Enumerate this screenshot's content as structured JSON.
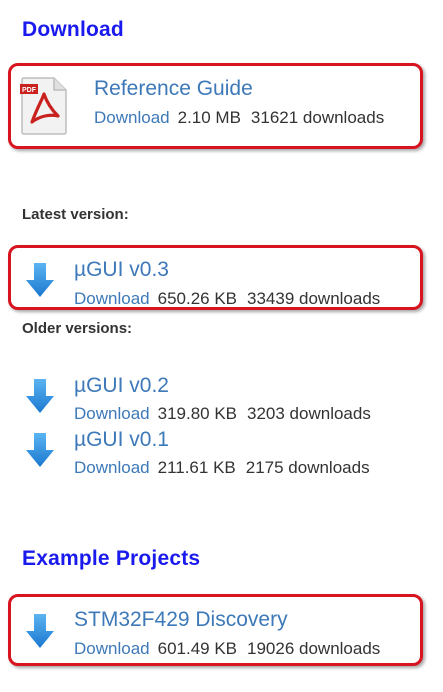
{
  "sections": {
    "download_heading": "Download",
    "latest_label": "Latest version:",
    "older_label": "Older versions:",
    "examples_heading": "Example Projects"
  },
  "files": {
    "reference": {
      "title": "Reference Guide",
      "link": "Download",
      "size": "2.10 MB",
      "downloads": "31621 downloads",
      "icon": "pdf-icon"
    },
    "v03": {
      "title": "µGUI v0.3",
      "link": "Download",
      "size": "650.26 KB",
      "downloads": "33439 downloads",
      "icon": "download-arrow-icon"
    },
    "v02": {
      "title": "µGUI v0.2",
      "link": "Download",
      "size": "319.80 KB",
      "downloads": "3203 downloads",
      "icon": "download-arrow-icon"
    },
    "v01": {
      "title": "µGUI v0.1",
      "link": "Download",
      "size": "211.61 KB",
      "downloads": "2175 downloads",
      "icon": "download-arrow-icon"
    },
    "stm32": {
      "title": "STM32F429 Discovery",
      "link": "Download",
      "size": "601.49 KB",
      "downloads": "19026 downloads",
      "icon": "download-arrow-icon"
    }
  },
  "colors": {
    "heading": "#1a1aef",
    "link": "#3d79b8",
    "highlight_border": "#d7141f",
    "arrow": "#2a8fe0",
    "pdf_red": "#c9211e"
  }
}
